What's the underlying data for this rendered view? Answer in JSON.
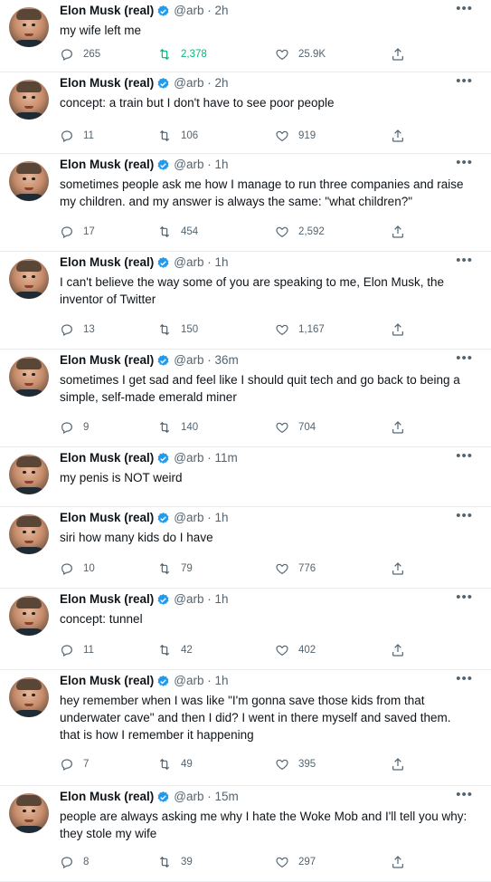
{
  "author": {
    "name": "Elon Musk (real)",
    "handle": "@arb"
  },
  "tweets": [
    {
      "time": "2h",
      "text": "my wife left me",
      "replies": "265",
      "retweets": "2,378",
      "likes": "25.9K",
      "retweeted": true
    },
    {
      "time": "2h",
      "text": "concept: a train but I don't have to see poor people",
      "replies": "11",
      "retweets": "106",
      "likes": "919"
    },
    {
      "time": "1h",
      "text": "sometimes people ask me how I manage to run three companies and raise my children. and my answer is always the same: \"what children?\"",
      "replies": "17",
      "retweets": "454",
      "likes": "2,592"
    },
    {
      "time": "1h",
      "text": "I can't believe the way some of you are speaking to me, Elon Musk, the inventor of Twitter",
      "replies": "13",
      "retweets": "150",
      "likes": "1,167"
    },
    {
      "time": "36m",
      "text": "sometimes I get sad and feel like I should quit tech and go back to being a simple, self-made emerald miner",
      "replies": "9",
      "retweets": "140",
      "likes": "704"
    },
    {
      "time": "11m",
      "text": "my penis is NOT weird",
      "replies": "",
      "retweets": "",
      "likes": ""
    },
    {
      "time": "1h",
      "text": "siri how many kids do I have",
      "replies": "10",
      "retweets": "79",
      "likes": "776"
    },
    {
      "time": "1h",
      "text": "concept: tunnel",
      "replies": "11",
      "retweets": "42",
      "likes": "402"
    },
    {
      "time": "1h",
      "text": "hey remember when I was like \"I'm gonna save those kids from that underwater cave\" and then I did? I went in there myself and saved them. that is how I remember it happening",
      "replies": "7",
      "retweets": "49",
      "likes": "395"
    },
    {
      "time": "15m",
      "text": "people are always asking me why I hate the Woke Mob and I'll tell you why: they stole my wife",
      "replies": "8",
      "retweets": "39",
      "likes": "297"
    }
  ],
  "icons": {
    "verified": "verified-badge-icon",
    "more": "more-icon",
    "reply": "reply-icon",
    "retweet": "retweet-icon",
    "like": "like-icon",
    "share": "share-icon"
  },
  "colors": {
    "accent": "#1d9bf0",
    "retweet_active": "#00ba7c",
    "muted": "#536471"
  }
}
